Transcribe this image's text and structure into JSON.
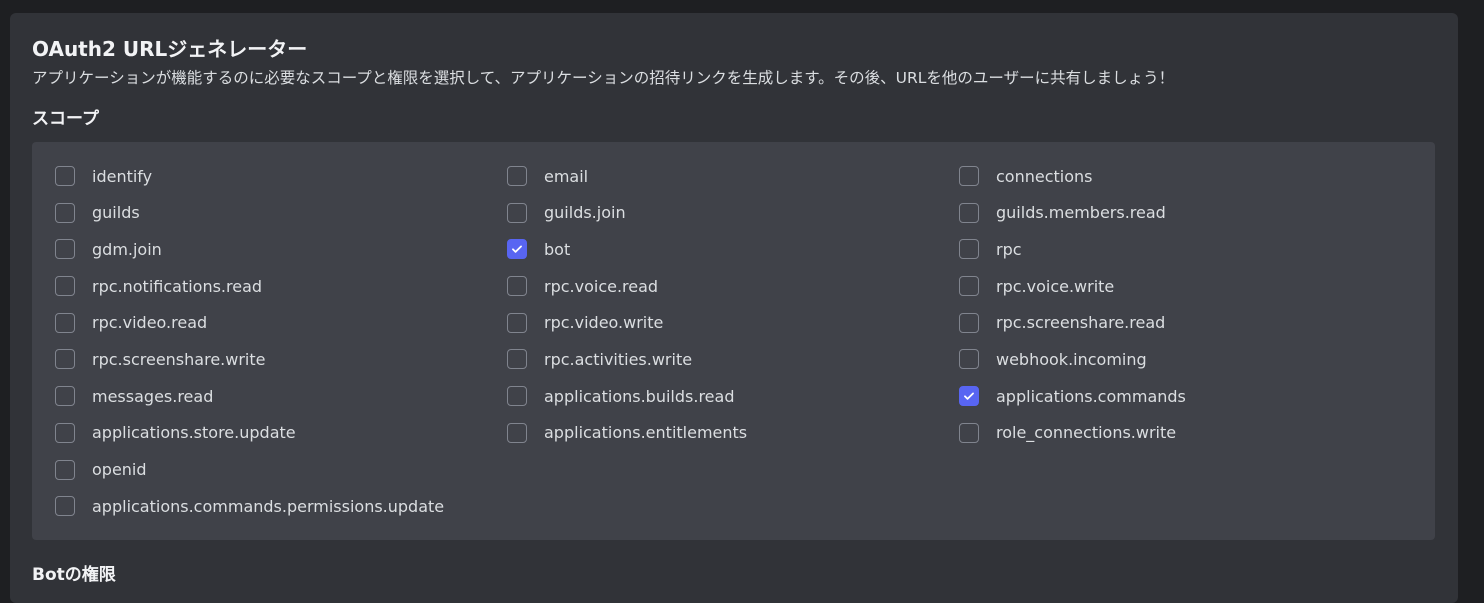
{
  "generator": {
    "title": "OAuth2 URLジェネレーター",
    "description": "アプリケーションが機能するのに必要なスコープと権限を選択して、アプリケーションの招待リンクを生成します。その後、URLを他のユーザーに共有しましょう！",
    "scopes_heading": "スコープ",
    "next_heading": "Botの権限"
  },
  "scopes": [
    {
      "label": "identify",
      "checked": false
    },
    {
      "label": "email",
      "checked": false
    },
    {
      "label": "connections",
      "checked": false
    },
    {
      "label": "guilds",
      "checked": false
    },
    {
      "label": "guilds.join",
      "checked": false
    },
    {
      "label": "guilds.members.read",
      "checked": false
    },
    {
      "label": "gdm.join",
      "checked": false
    },
    {
      "label": "bot",
      "checked": true
    },
    {
      "label": "rpc",
      "checked": false
    },
    {
      "label": "rpc.notifications.read",
      "checked": false
    },
    {
      "label": "rpc.voice.read",
      "checked": false
    },
    {
      "label": "rpc.voice.write",
      "checked": false
    },
    {
      "label": "rpc.video.read",
      "checked": false
    },
    {
      "label": "rpc.video.write",
      "checked": false
    },
    {
      "label": "rpc.screenshare.read",
      "checked": false
    },
    {
      "label": "rpc.screenshare.write",
      "checked": false
    },
    {
      "label": "rpc.activities.write",
      "checked": false
    },
    {
      "label": "webhook.incoming",
      "checked": false
    },
    {
      "label": "messages.read",
      "checked": false
    },
    {
      "label": "applications.builds.read",
      "checked": false
    },
    {
      "label": "applications.commands",
      "checked": true
    },
    {
      "label": "applications.store.update",
      "checked": false
    },
    {
      "label": "applications.entitlements",
      "checked": false
    },
    {
      "label": "role_connections.write",
      "checked": false
    },
    {
      "label": "openid",
      "checked": false
    },
    {
      "label": "",
      "checked": false,
      "empty": true
    },
    {
      "label": "",
      "checked": false,
      "empty": true
    },
    {
      "label": "applications.commands.permissions.update",
      "checked": false
    }
  ],
  "colors": {
    "accent": "#5865f2",
    "panel": "#313338",
    "scope_box": "#404249"
  }
}
